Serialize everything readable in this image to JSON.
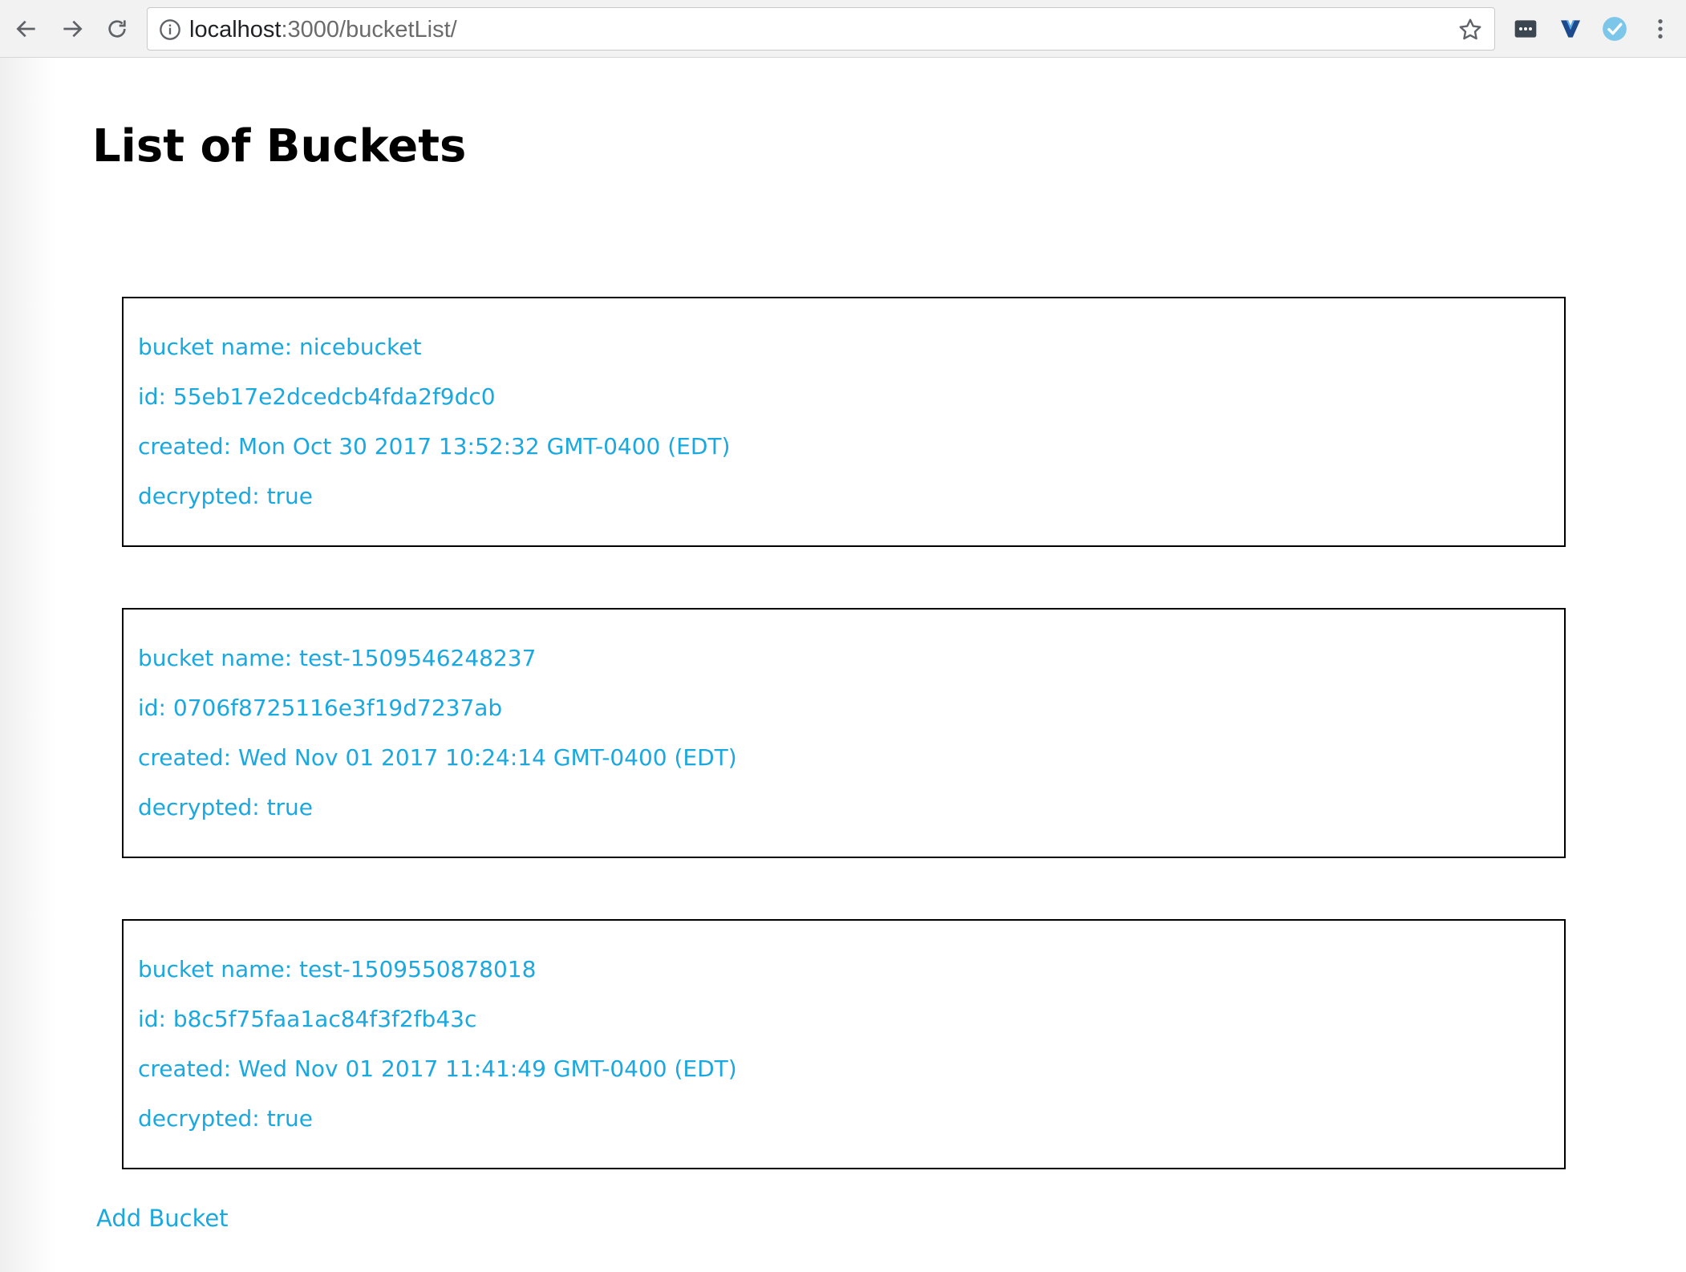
{
  "browser": {
    "url_host": "localhost",
    "url_rest": ":3000/bucketList/"
  },
  "page": {
    "title": "List of Buckets",
    "add_bucket_label": "Add Bucket"
  },
  "buckets": [
    {
      "name": "bucket name: nicebucket",
      "id": "id: 55eb17e2dcedcb4fda2f9dc0",
      "created": "created: Mon Oct 30 2017 13:52:32 GMT-0400 (EDT)",
      "decrypted": "decrypted: true"
    },
    {
      "name": "bucket name: test-1509546248237",
      "id": "id: 0706f8725116e3f19d7237ab",
      "created": "created: Wed Nov 01 2017 10:24:14 GMT-0400 (EDT)",
      "decrypted": "decrypted: true"
    },
    {
      "name": "bucket name: test-1509550878018",
      "id": "id: b8c5f75faa1ac84f3f2fb43c",
      "created": "created: Wed Nov 01 2017 11:41:49 GMT-0400 (EDT)",
      "decrypted": "decrypted: true"
    }
  ],
  "colors": {
    "link": "#1aa8df",
    "border": "#000000"
  },
  "icons": [
    "back-arrow-icon",
    "forward-arrow-icon",
    "reload-icon",
    "info-icon",
    "bookmark-star-icon",
    "password-manager-extension-icon",
    "v-extension-icon",
    "checkmark-extension-icon",
    "kebab-menu-icon"
  ]
}
